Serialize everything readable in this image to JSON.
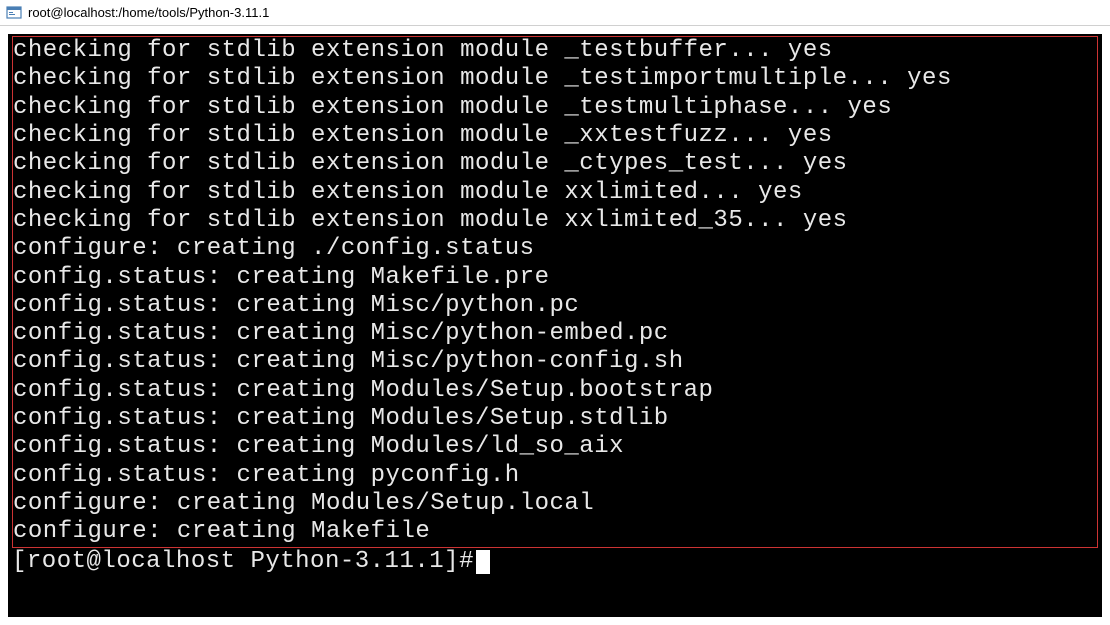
{
  "window": {
    "title": "root@localhost:/home/tools/Python-3.11.1"
  },
  "terminal": {
    "output_lines": [
      "checking for stdlib extension module _testbuffer... yes",
      "checking for stdlib extension module _testimportmultiple... yes",
      "checking for stdlib extension module _testmultiphase... yes",
      "checking for stdlib extension module _xxtestfuzz... yes",
      "checking for stdlib extension module _ctypes_test... yes",
      "checking for stdlib extension module xxlimited... yes",
      "checking for stdlib extension module xxlimited_35... yes",
      "configure: creating ./config.status",
      "config.status: creating Makefile.pre",
      "config.status: creating Misc/python.pc",
      "config.status: creating Misc/python-embed.pc",
      "config.status: creating Misc/python-config.sh",
      "config.status: creating Modules/Setup.bootstrap",
      "config.status: creating Modules/Setup.stdlib",
      "config.status: creating Modules/ld_so_aix",
      "config.status: creating pyconfig.h",
      "configure: creating Modules/Setup.local",
      "configure: creating Makefile"
    ],
    "prompt": "[root@localhost Python-3.11.1]#"
  }
}
